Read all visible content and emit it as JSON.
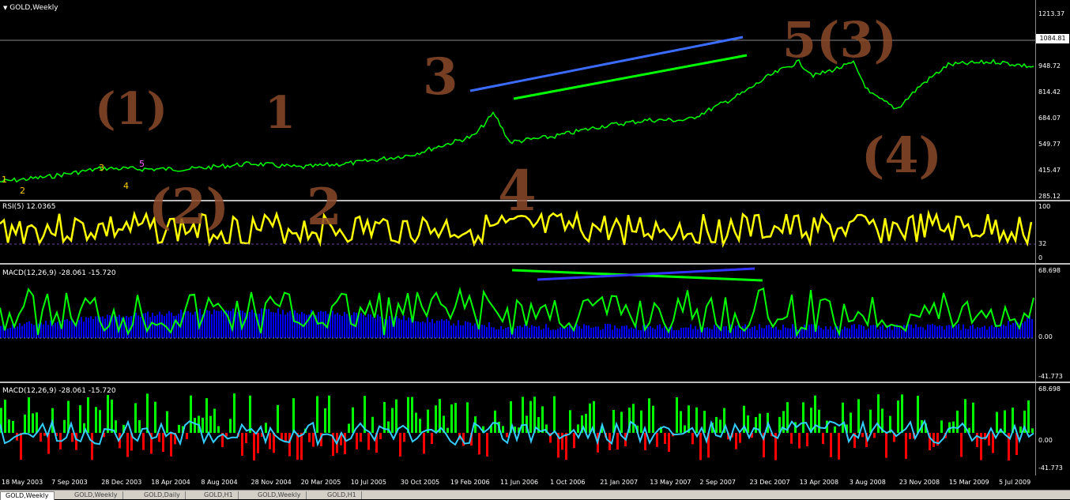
{
  "window": {
    "title": "GOLD,Weekly"
  },
  "colors": {
    "price": "#00ff00",
    "rsi": "#ffff00",
    "macd_hist": "#0000ff",
    "macd_line": "#00ff00",
    "up_bar": "#00ff00",
    "down_bar": "#ff0000",
    "annotation": "#8b4a2b"
  },
  "price_axis": {
    "ticks": [
      "1213.37",
      "1084.81",
      "948.72",
      "814.42",
      "684.07",
      "549.77",
      "415.47",
      "285.12"
    ],
    "current": "1084.81"
  },
  "wave_counts": [
    "1",
    "2",
    "3",
    "4",
    "5"
  ],
  "annotations": [
    "(1)",
    "1",
    "3",
    "5(3)",
    "(2)",
    "2",
    "(4)",
    "4"
  ],
  "rsi": {
    "label": "RSI(5) 12.0365",
    "ticks": [
      "100",
      "32",
      "0"
    ]
  },
  "macd1": {
    "label": "MACD(12,26,9) -28.061 -15.720",
    "ticks": [
      "68.698",
      "0.00",
      "-41.773"
    ]
  },
  "macd2": {
    "label": "MACD(12,26,9) -28.061 -15.720",
    "ticks": [
      "68.698",
      "0.00",
      "-41.773"
    ]
  },
  "x_axis": [
    "18 May 2003",
    "7 Sep 2003",
    "28 Dec 2003",
    "18 Apr 2004",
    "8 Aug 2004",
    "28 Nov 2004",
    "20 Mar 2005",
    "10 Jul 2005",
    "30 Oct 2005",
    "19 Feb 2006",
    "11 Jun 2006",
    "1 Oct 2006",
    "21 Jan 2007",
    "13 May 2007",
    "2 Sep 2007",
    "23 Dec 2007",
    "13 Apr 2008",
    "3 Aug 2008",
    "23 Nov 2008",
    "15 Mar 2009",
    "5 Jul 2009"
  ],
  "tabs": [
    "GOLD,Weekly",
    "GOLD,Weekly",
    "GOLD,Daily",
    "GOLD,H1",
    "GOLD,Weekly",
    "GOLD,H1"
  ]
}
